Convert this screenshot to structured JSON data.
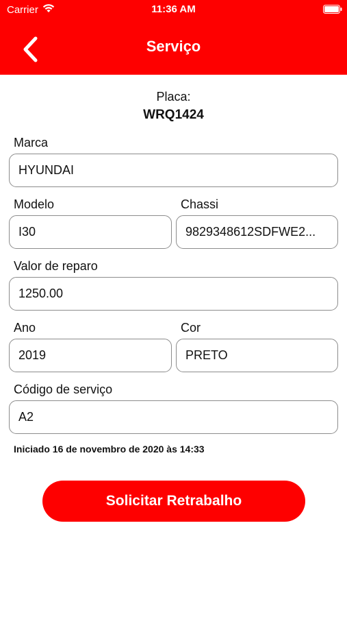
{
  "status_bar": {
    "carrier": "Carrier",
    "time": "11:36 AM",
    "icons": [
      "wifi-icon",
      "battery-icon"
    ]
  },
  "nav": {
    "title": "Serviço",
    "back_icon": "chevron-left-icon"
  },
  "placa": {
    "label": "Placa:",
    "value": "WRQ1424"
  },
  "fields": {
    "marca": {
      "label": "Marca",
      "value": "HYUNDAI"
    },
    "modelo": {
      "label": "Modelo",
      "value": "I30"
    },
    "chassi": {
      "label": "Chassi",
      "value": "9829348612SDFWE2..."
    },
    "valor_reparo": {
      "label": "Valor de reparo",
      "value": "1250.00"
    },
    "ano": {
      "label": "Ano",
      "value": "2019"
    },
    "cor": {
      "label": "Cor",
      "value": "PRETO"
    },
    "codigo_servico": {
      "label": "Código de serviço",
      "value": "A2"
    }
  },
  "started_text": "Iniciado 16 de novembro de 2020 às 14:33",
  "cta_label": "Solicitar Retrabalho",
  "colors": {
    "brand_red": "#fe0000",
    "field_border": "#8c8c8c"
  }
}
